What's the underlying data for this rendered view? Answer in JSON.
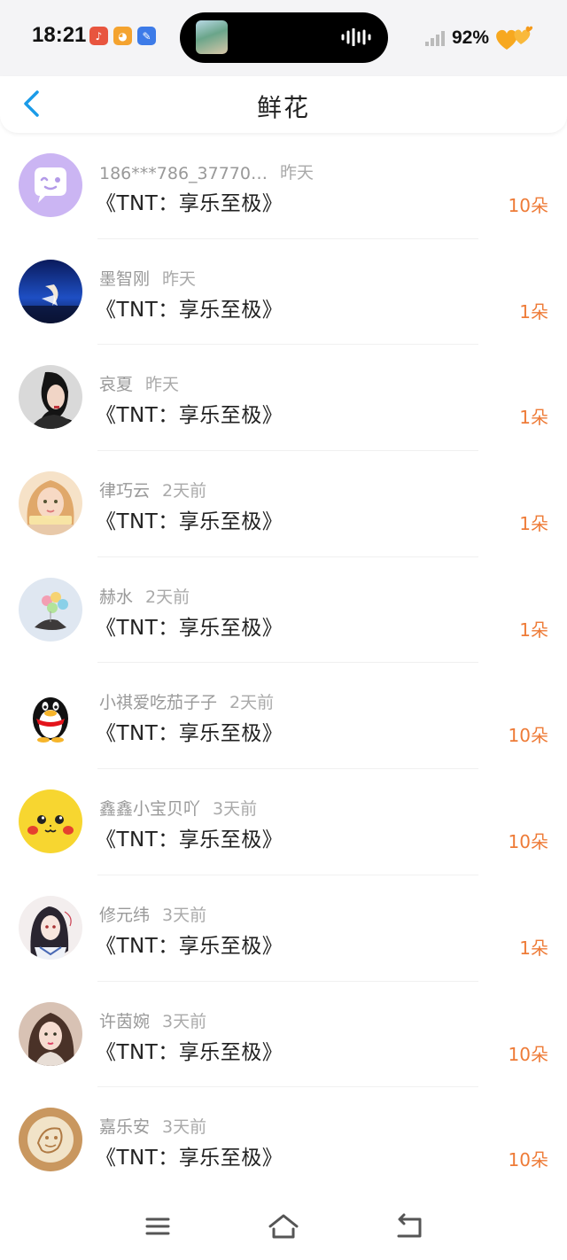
{
  "status_bar": {
    "time": "18:21",
    "battery": "92%",
    "app_icons": [
      {
        "name": "tiktok-icon",
        "glyph": "♪",
        "color": "#e8553f"
      },
      {
        "name": "orange-app-icon",
        "glyph": "●",
        "color": "#f4a32f"
      },
      {
        "name": "blue-app-icon",
        "glyph": "✎",
        "color": "#3d7be8"
      }
    ]
  },
  "header": {
    "title": "鲜花"
  },
  "colors": {
    "accent_count": "#ee7b37",
    "back_arrow": "#1a9be8"
  },
  "gifts": [
    {
      "user": "186***786_37770…",
      "time": "昨天",
      "book": "《TNT：享乐至极》",
      "count": "10朵",
      "avatar": "qq-bubble-avatar"
    },
    {
      "user": "墨智刚",
      "time": "昨天",
      "book": "《TNT：享乐至极》",
      "count": "1朵",
      "avatar": "night-sky-avatar"
    },
    {
      "user": "哀夏",
      "time": "昨天",
      "book": "《TNT：享乐至极》",
      "count": "1朵",
      "avatar": "portrait-avatar"
    },
    {
      "user": "律巧云",
      "time": "2天前",
      "book": "《TNT：享乐至极》",
      "count": "1朵",
      "avatar": "girl-avatar"
    },
    {
      "user": "赫水",
      "time": "2天前",
      "book": "《TNT：享乐至极》",
      "count": "1朵",
      "avatar": "balloons-avatar"
    },
    {
      "user": "小祺爱吃茄子子",
      "time": "2天前",
      "book": "《TNT：享乐至极》",
      "count": "10朵",
      "avatar": "qq-penguin-avatar"
    },
    {
      "user": "鑫鑫小宝贝吖",
      "time": "3天前",
      "book": "《TNT：享乐至极》",
      "count": "10朵",
      "avatar": "pikachu-avatar"
    },
    {
      "user": "修元纬",
      "time": "3天前",
      "book": "《TNT：享乐至极》",
      "count": "1朵",
      "avatar": "anime-avatar"
    },
    {
      "user": "许茵婉",
      "time": "3天前",
      "book": "《TNT：享乐至极》",
      "count": "10朵",
      "avatar": "selfie-avatar"
    },
    {
      "user": "嘉乐安",
      "time": "3天前",
      "book": "《TNT：享乐至极》",
      "count": "10朵",
      "avatar": "latte-art-avatar"
    }
  ]
}
